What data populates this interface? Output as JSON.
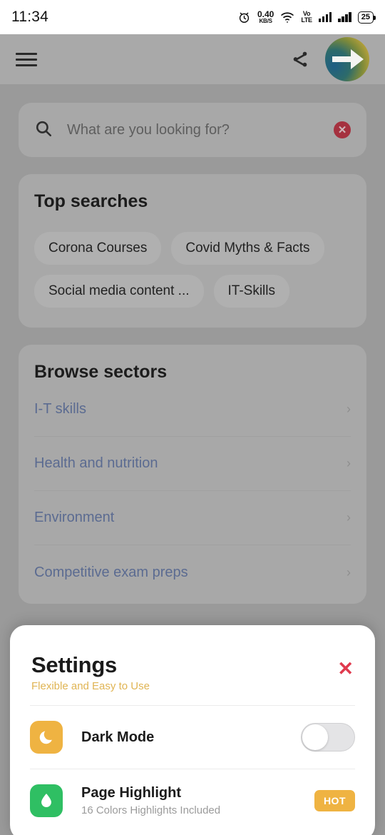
{
  "status_bar": {
    "time": "11:34",
    "alarm_icon": "alarm-clock-icon",
    "net_speed_rate": "0.40",
    "net_speed_unit": "KB/S",
    "wifi_icon": "wifi-icon",
    "volte_line1": "Vo",
    "volte_line2": "LTE",
    "signal_icon_1": "signal-bars-icon",
    "signal_icon_2": "signal-bars-icon",
    "battery_level": "25"
  },
  "app_bar": {
    "menu_icon": "hamburger-menu-icon",
    "share_icon": "share-icon",
    "avatar_icon": "profile-logo-arrow-icon"
  },
  "search": {
    "icon": "search-icon",
    "placeholder": "What are you looking for?",
    "value": "",
    "clear_icon": "clear-circle-icon"
  },
  "top_searches": {
    "title": "Top searches",
    "chips": [
      "Corona Courses",
      "Covid Myths & Facts",
      "Social media content ...",
      "IT-Skills"
    ]
  },
  "browse_sectors": {
    "title": "Browse sectors",
    "items": [
      {
        "label": "I-T skills",
        "chevron": "chevron-right-icon"
      },
      {
        "label": "Health and nutrition",
        "chevron": "chevron-right-icon"
      },
      {
        "label": "Environment",
        "chevron": "chevron-right-icon"
      }
    ]
  },
  "behind_sheet": {
    "partial_item": "Competitive exam preps"
  },
  "settings_sheet": {
    "title": "Settings",
    "subtitle": "Flexible and Easy to Use",
    "close_icon": "close-x-icon",
    "close_glyph": "✕",
    "rows": [
      {
        "icon": "moon-icon",
        "icon_color": "#efb342",
        "label": "Dark Mode",
        "subtitle": "",
        "control": "toggle",
        "toggle_on": false
      },
      {
        "icon": "water-drop-icon",
        "icon_color": "#2fbf63",
        "label": "Page Highlight",
        "subtitle": "16 Colors Highlights Included",
        "control": "badge",
        "badge_label": "HOT"
      }
    ]
  },
  "colors": {
    "accent_amber": "#efb342",
    "accent_green": "#2fbf63",
    "accent_red": "#e03a4e",
    "link_blue": "#5b6b91",
    "scrim": "#9a9a9a"
  }
}
